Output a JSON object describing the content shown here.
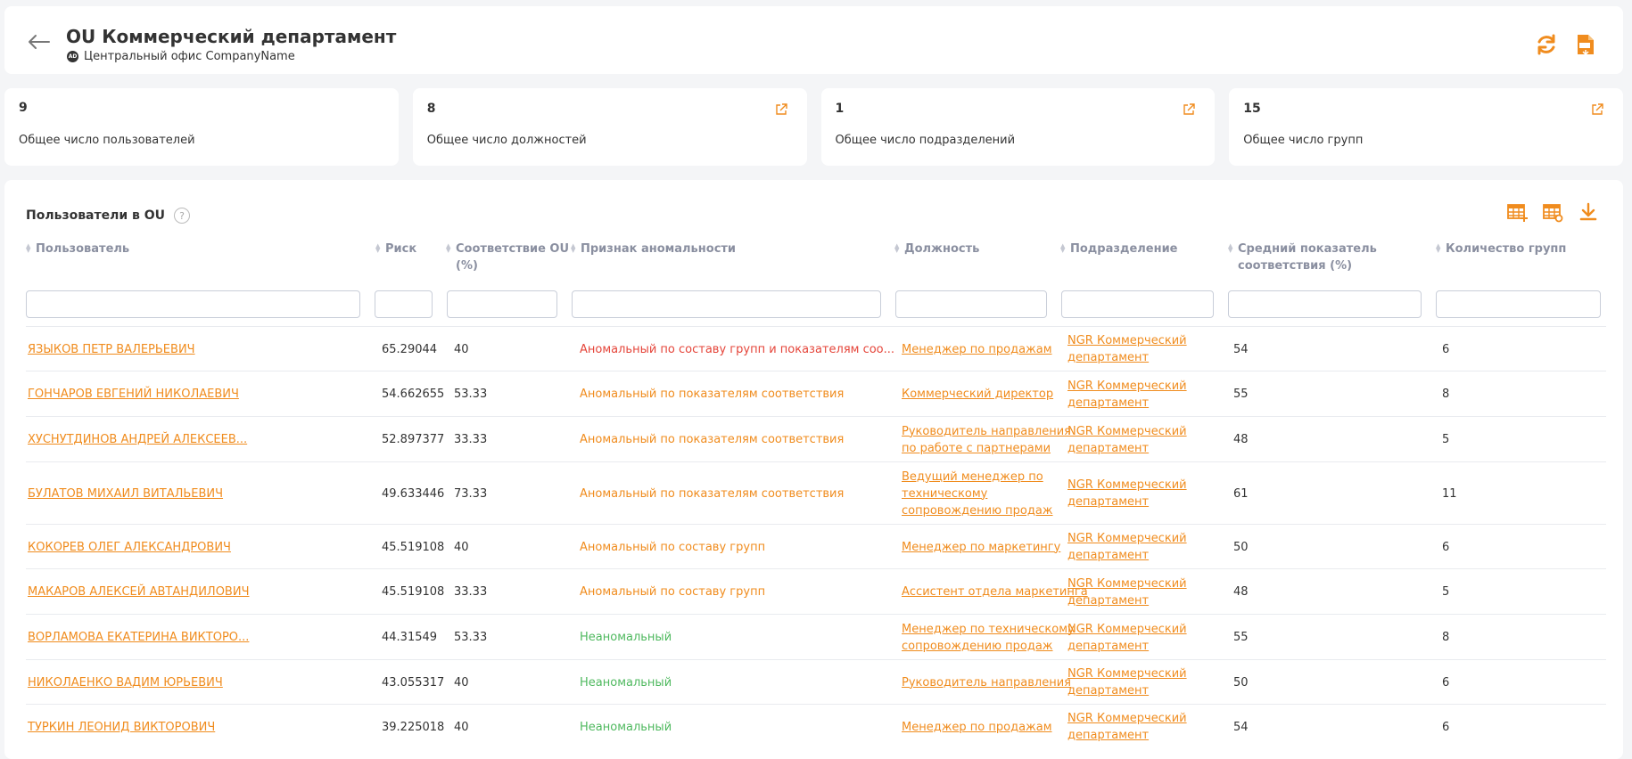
{
  "header": {
    "title": "OU Коммерческий департамент",
    "subtitle_badge": "AD",
    "subtitle": "Центральный офис CompanyName",
    "icons": [
      "back-arrow-icon",
      "refresh-icon",
      "pdf-export-icon"
    ]
  },
  "stats": [
    {
      "value": "9",
      "label": "Общее число пользователей"
    },
    {
      "value": "8",
      "label": "Общее число должностей"
    },
    {
      "value": "1",
      "label": "Общее число подразделений"
    },
    {
      "value": "15",
      "label": "Общее число групп"
    }
  ],
  "panel": {
    "title": "Пользователи в OU",
    "help": "?"
  },
  "columns": [
    {
      "line1": "Пользователь",
      "line2": ""
    },
    {
      "line1": "Риск",
      "line2": ""
    },
    {
      "line1": "Соответствие OU",
      "line2": "(%)"
    },
    {
      "line1": "Признак аномальности",
      "line2": ""
    },
    {
      "line1": "Должность",
      "line2": ""
    },
    {
      "line1": "Подразделение",
      "line2": ""
    },
    {
      "line1": "Средний показатель",
      "line2": "соответствия (%)"
    },
    {
      "line1": "Количество групп",
      "line2": ""
    }
  ],
  "rows": [
    {
      "user": "ЯЗЫКОВ ПЕТР ВАЛЕРЬЕВИЧ",
      "risk": "65.29044",
      "match": "40",
      "anomaly": "Аномальный по составу групп и показателям соо...",
      "anomaly_level": "red",
      "position": [
        "Менеджер по продажам"
      ],
      "dept": [
        "NGR Коммерческий",
        "департамент"
      ],
      "avg": "54",
      "groups": "6"
    },
    {
      "user": "ГОНЧАРОВ ЕВГЕНИЙ НИКОЛАЕВИЧ",
      "risk": "54.662655",
      "match": "53.33",
      "anomaly": "Аномальный по показателям соответствия",
      "anomaly_level": "orange",
      "position": [
        "Коммерческий директор"
      ],
      "dept": [
        "NGR Коммерческий",
        "департамент"
      ],
      "avg": "55",
      "groups": "8"
    },
    {
      "user": "ХУСНУТДИНОВ АНДРЕЙ АЛЕКСЕЕВ...",
      "risk": "52.897377",
      "match": "33.33",
      "anomaly": "Аномальный по показателям соответствия",
      "anomaly_level": "orange",
      "position": [
        "Руководитель направления",
        "по работе с партнерами"
      ],
      "dept": [
        "NGR Коммерческий",
        "департамент"
      ],
      "avg": "48",
      "groups": "5"
    },
    {
      "user": "БУЛАТОВ МИХАИЛ ВИТАЛЬЕВИЧ",
      "risk": "49.633446",
      "match": "73.33",
      "anomaly": "Аномальный по показателям соответствия",
      "anomaly_level": "orange",
      "position": [
        "Ведущий менеджер по",
        "техническому",
        "сопровождению продаж"
      ],
      "dept": [
        "NGR Коммерческий",
        "департамент"
      ],
      "avg": "61",
      "groups": "11"
    },
    {
      "user": "КОКОРЕВ ОЛЕГ АЛЕКСАНДРОВИЧ",
      "risk": "45.519108",
      "match": "40",
      "anomaly": "Аномальный по составу групп",
      "anomaly_level": "orange",
      "position": [
        "Менеджер по маркетингу"
      ],
      "dept": [
        "NGR Коммерческий",
        "департамент"
      ],
      "avg": "50",
      "groups": "6"
    },
    {
      "user": "МАКАРОВ АЛЕКСЕЙ АВТАНДИЛОВИЧ",
      "risk": "45.519108",
      "match": "33.33",
      "anomaly": "Аномальный по составу групп",
      "anomaly_level": "orange",
      "position": [
        "Ассистент отдела маркетинга"
      ],
      "dept": [
        "NGR Коммерческий",
        "департамент"
      ],
      "avg": "48",
      "groups": "5"
    },
    {
      "user": "ВОРЛАМОВА ЕКАТЕРИНА ВИКТОРО...",
      "risk": "44.31549",
      "match": "53.33",
      "anomaly": "Неаномальный",
      "anomaly_level": "green",
      "position": [
        "Менеджер по техническому",
        "сопровождению продаж"
      ],
      "dept": [
        "NGR Коммерческий",
        "департамент"
      ],
      "avg": "55",
      "groups": "8"
    },
    {
      "user": "НИКОЛАЕНКО ВАДИМ ЮРЬЕВИЧ",
      "risk": "43.055317",
      "match": "40",
      "anomaly": "Неаномальный",
      "anomaly_level": "green",
      "position": [
        "Руководитель направления"
      ],
      "dept": [
        "NGR Коммерческий",
        "департамент"
      ],
      "avg": "50",
      "groups": "6"
    },
    {
      "user": "ТУРКИН ЛЕОНИД ВИКТОРОВИЧ",
      "risk": "39.225018",
      "match": "40",
      "anomaly": "Неаномальный",
      "anomaly_level": "green",
      "position": [
        "Менеджер по продажам"
      ],
      "dept": [
        "NGR Коммерческий",
        "департамент"
      ],
      "avg": "54",
      "groups": "6"
    }
  ],
  "colors": {
    "accent": "#f08c1e",
    "anomaly_red": "#e5453a",
    "anomaly_green": "#4fb95f"
  }
}
